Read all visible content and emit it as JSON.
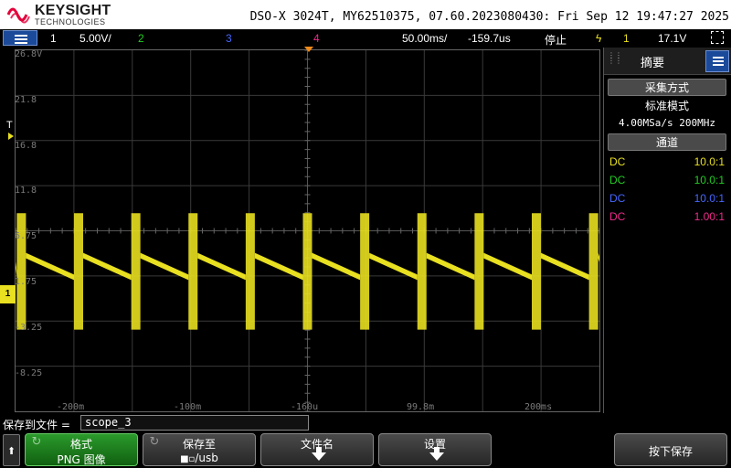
{
  "header": {
    "brand": "KEYSIGHT",
    "brand_sub": "TECHNOLOGIES",
    "model_info": "DSO-X 3024T, MY62510375, 07.60.2023080430: Fri Sep 12 19:47:27 2025"
  },
  "statusbar": {
    "ch1_num": "1",
    "ch1_scale": "5.00V/",
    "ch2_num": "2",
    "ch3_num": "3",
    "ch4_num": "4",
    "timebase": "50.00ms/",
    "delay": "-159.7us",
    "run_state": "停止",
    "trig_icon": "ϟ",
    "trig_ch": "1",
    "trig_level": "17.1V"
  },
  "markers": {
    "trigger_t": "T",
    "ch1_ground": "1"
  },
  "colors": {
    "ch1": "#e8e020",
    "ch2": "#22cc22",
    "ch3": "#4466ff",
    "ch4": "#ee2a8a",
    "trigger_marker": "#f08a1a"
  },
  "y_axis_labels": [
    "26.8V",
    "21.8",
    "16.8",
    "11.8",
    "6.75",
    "1.75",
    "-3.25",
    "-8.25"
  ],
  "x_axis_labels": [
    "-200m",
    "-100m",
    "-160u",
    "99.8m",
    "200ms"
  ],
  "side_panel": {
    "title": "摘要",
    "acq_header": "采集方式",
    "acq_mode": "标准模式",
    "acq_rate": "4.00MSa/s  200MHz",
    "channel_header": "通道",
    "channels": [
      {
        "coupling": "DC",
        "probe": "10.0:1",
        "color": "#e8e020"
      },
      {
        "coupling": "DC",
        "probe": "10.0:1",
        "color": "#22cc22"
      },
      {
        "coupling": "DC",
        "probe": "10.0:1",
        "color": "#4466ff"
      },
      {
        "coupling": "DC",
        "probe": "1.00:1",
        "color": "#ee2a8a"
      }
    ]
  },
  "save_bar": {
    "label": "保存到文件 =",
    "filename": "scope_3"
  },
  "softkeys": {
    "up_arrow": "⬆",
    "format_label": "格式",
    "format_value": "PNG 图像",
    "save_to_label": "保存至",
    "save_to_value": "/usb",
    "filename_label": "文件名",
    "settings_label": "设置",
    "press_save_label": "按下保存"
  },
  "chart_data": {
    "type": "line",
    "title": "",
    "xlabel": "",
    "ylabel": "",
    "series": [
      {
        "x_ms": [
          -250,
          -203,
          -203,
          -153,
          -153,
          -103,
          -103,
          -53,
          -53,
          -3,
          -3,
          47,
          47,
          97,
          97,
          147,
          147,
          197,
          197,
          247,
          247,
          250
        ],
        "y_V": [
          1.5,
          -2.0,
          4.0,
          -2.0,
          4.0,
          -2.0,
          4.0,
          -2.0,
          4.0,
          -2.0,
          4.0,
          -2.0,
          4.0,
          -2.0,
          4.0,
          -2.0,
          4.0,
          -2.0,
          4.0,
          -2.0,
          4.0,
          3.8
        ],
        "pulses_x_ms": [
          -245,
          -196,
          -147,
          -98,
          -49,
          0,
          49,
          98,
          147,
          196,
          245
        ],
        "pulse_high_V": 8.7,
        "pulse_low_V": -4.2,
        "baseline_start_V": 4.0,
        "baseline_end_V": 1.6
      }
    ],
    "xlim_ms": [
      -250,
      250
    ],
    "ylim_V": [
      -13.25,
      26.75
    ],
    "grid": true
  }
}
